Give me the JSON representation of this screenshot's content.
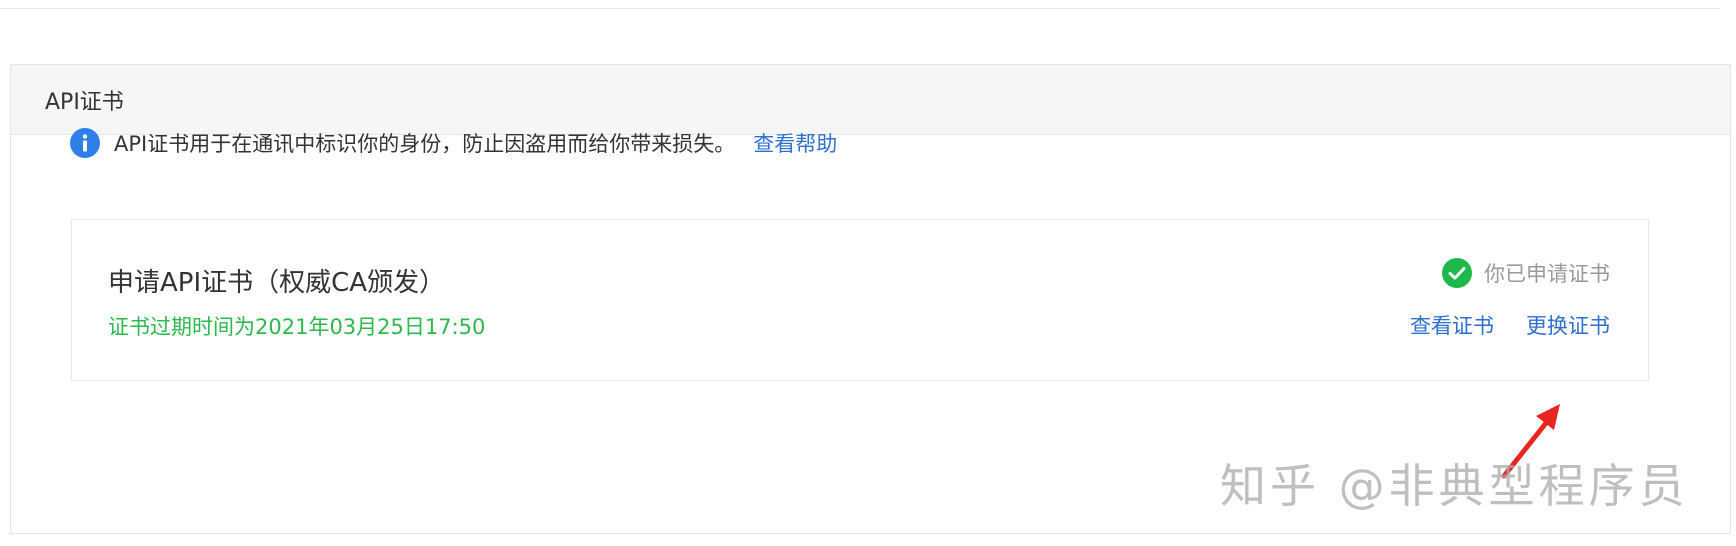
{
  "panel": {
    "title": "API证书"
  },
  "notice": {
    "icon": "info-icon",
    "text": "API证书用于在通讯中标识你的身份，防止因盗用而给你带来损失。",
    "help_link": "查看帮助"
  },
  "certificate": {
    "title": "申请API证书（权威CA颁发）",
    "expiry": "证书过期时间为2021年03月25日17:50",
    "status_icon": "check-circle-icon",
    "status_text": "你已申请证书",
    "actions": {
      "view": "查看证书",
      "replace": "更换证书"
    }
  },
  "annotation": {
    "arrow_icon": "red-arrow-icon",
    "arrow_color": "#e8261f"
  },
  "watermark": {
    "text": "知乎 @非典型程序员"
  },
  "colors": {
    "link": "#2e6fcf",
    "success": "#2db84d",
    "info": "#2e7fe8"
  }
}
